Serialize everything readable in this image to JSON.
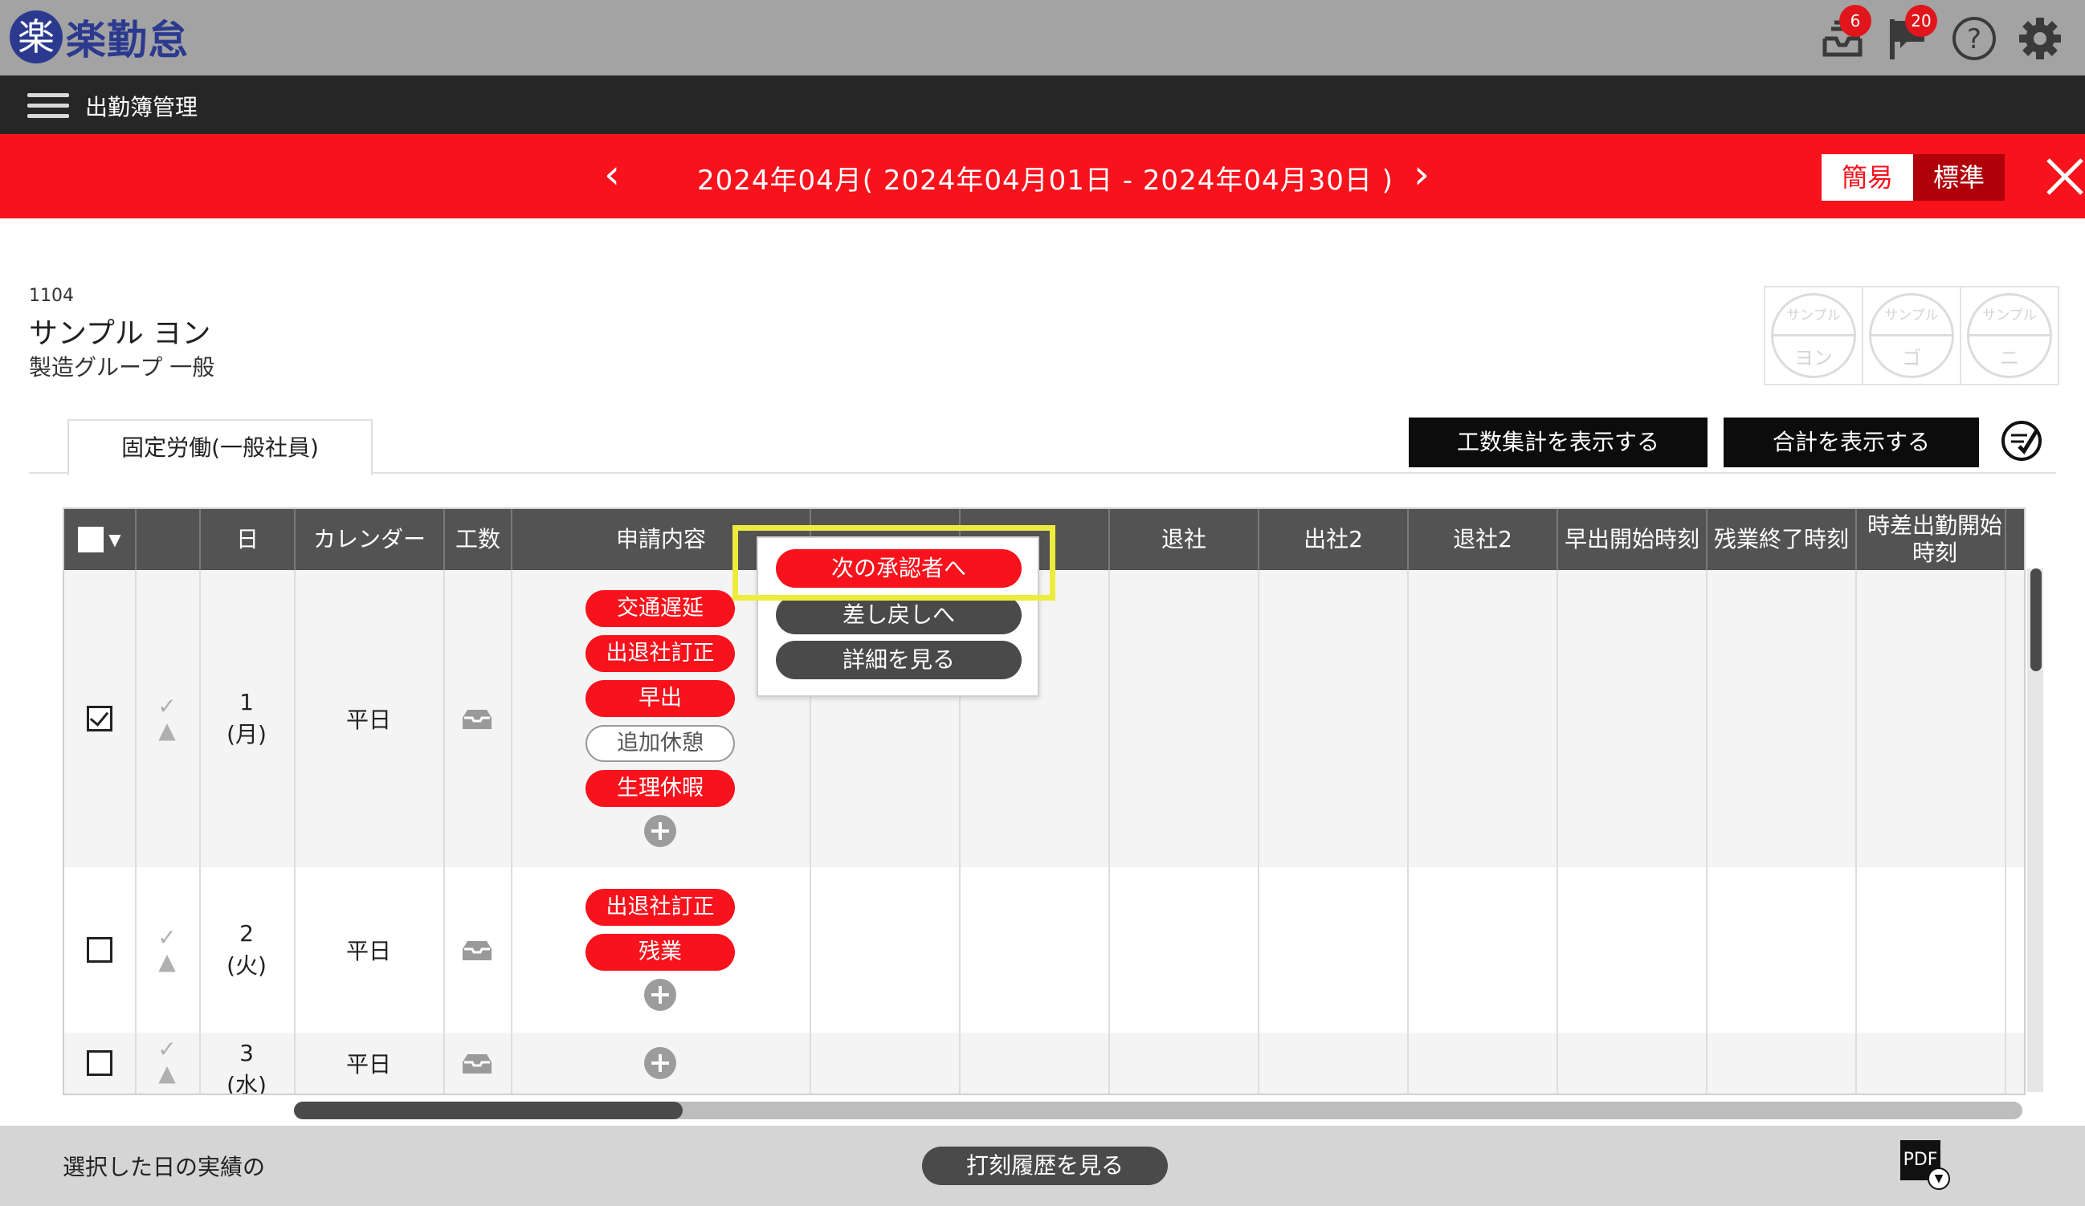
{
  "app": {
    "logo_mark": "楽",
    "logo_text": "楽勤怠",
    "badges": {
      "notifications": "6",
      "flags": "20"
    }
  },
  "nav": {
    "title": "出勤簿管理"
  },
  "period": {
    "text": "2024年04月( 2024年04月01日 - 2024年04月30日 )",
    "prev": "‹",
    "next": "›",
    "mode_simple": "簡易",
    "mode_standard": "標準"
  },
  "employee": {
    "id": "1104",
    "name": "サンプル ヨン",
    "group": "製造グループ 一般"
  },
  "stamps": [
    {
      "top": "サンプル",
      "bottom": "ヨン"
    },
    {
      "top": "サンプル",
      "bottom": "ゴ"
    },
    {
      "top": "サンプル",
      "bottom": "ニ"
    }
  ],
  "tabs": {
    "active": "固定労働(一般社員)"
  },
  "buttons": {
    "show_kousuu": "工数集計を表示する",
    "show_total": "合計を表示する"
  },
  "table": {
    "headers": [
      "日",
      "カレンダー",
      "工数",
      "申請内容",
      "",
      "",
      "退社",
      "出社2",
      "退社2",
      "早出開始時刻",
      "残業終了時刻",
      "時差出勤開始時刻"
    ],
    "rows": [
      {
        "day": "1",
        "weekday": "(月)",
        "calendar": "平日",
        "checked": true,
        "requests": [
          {
            "label": "交通遅延",
            "style": "red"
          },
          {
            "label": "出退社訂正",
            "style": "red"
          },
          {
            "label": "早出",
            "style": "red"
          },
          {
            "label": "追加休憩",
            "style": "outline"
          },
          {
            "label": "生理休暇",
            "style": "red"
          }
        ]
      },
      {
        "day": "2",
        "weekday": "(火)",
        "calendar": "平日",
        "checked": false,
        "requests": [
          {
            "label": "出退社訂正",
            "style": "red"
          },
          {
            "label": "残業",
            "style": "red"
          }
        ]
      },
      {
        "day": "3",
        "weekday": "(水)",
        "calendar": "平日",
        "checked": false,
        "requests": []
      }
    ]
  },
  "popup": {
    "next_approver": "次の承認者へ",
    "send_back": "差し戻しへ",
    "view_detail": "詳細を見る"
  },
  "footer": {
    "text": "選択した日の実績の",
    "history_button": "打刻履歴を見る",
    "pdf_label": "PDF"
  },
  "colors": {
    "brand_red": "#f7121c",
    "header_gray": "#535353",
    "logo_blue": "#2b3a8f",
    "highlight_yellow": "#ecec3c"
  },
  "icons": [
    "inbox-icon",
    "flag-icon",
    "help-icon",
    "gear-icon",
    "hamburger-icon",
    "close-icon",
    "check-circle-icon",
    "pdf-icon"
  ]
}
